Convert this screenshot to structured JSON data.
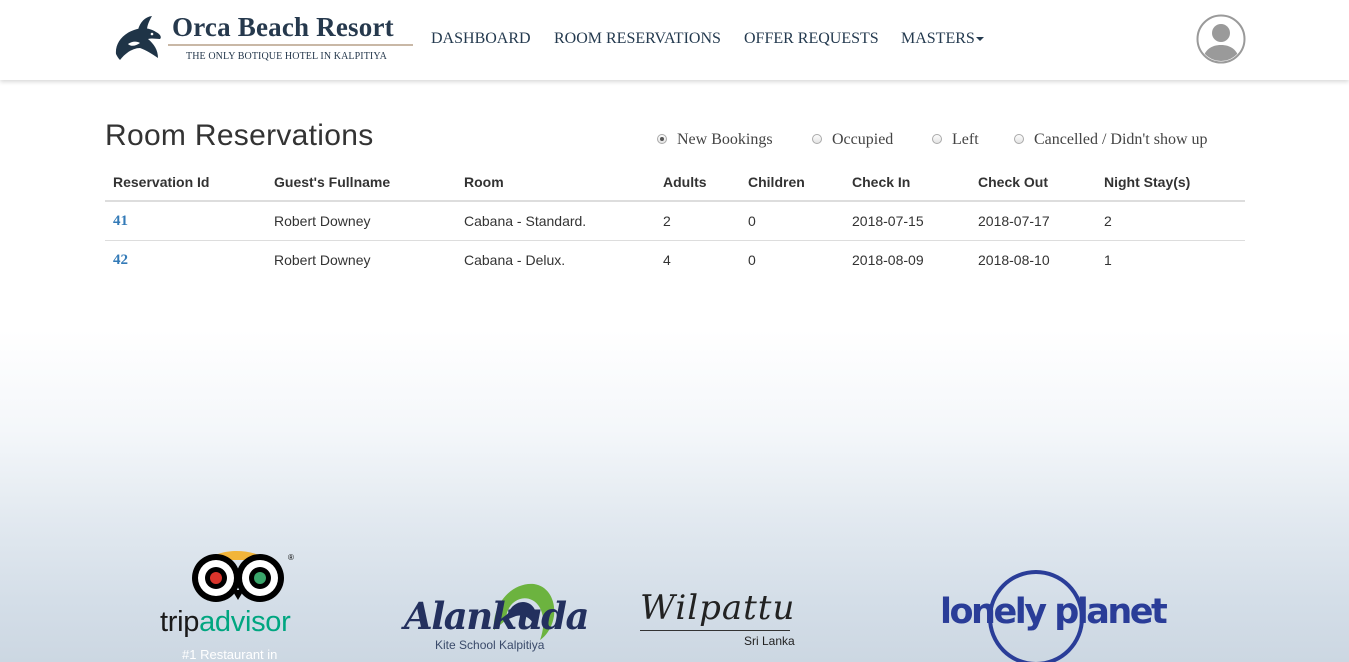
{
  "brand": {
    "name": "Orca Beach Resort",
    "tagline": "THE ONLY BOTIQUE HOTEL IN KALPITIYA"
  },
  "nav": {
    "dashboard": "DASHBOARD",
    "room_reservations": "ROOM RESERVATIONS",
    "offer_requests": "OFFER REQUESTS",
    "masters": "MASTERS"
  },
  "page": {
    "title": "Room Reservations"
  },
  "filters": {
    "selected": "New Bookings",
    "options": [
      "New Bookings",
      "Occupied",
      "Left",
      "Cancelled / Didn't show up"
    ]
  },
  "table": {
    "headers": [
      "Reservation Id",
      "Guest's Fullname",
      "Room",
      "Adults",
      "Children",
      "Check In",
      "Check Out",
      "Night Stay(s)"
    ],
    "rows": [
      [
        "41",
        "Robert Downey",
        "Cabana - Standard.",
        "2",
        "0",
        "2018-07-15",
        "2018-07-17",
        "2"
      ],
      [
        "42",
        "Robert Downey",
        "Cabana - Delux.",
        "4",
        "0",
        "2018-08-09",
        "2018-08-10",
        "1"
      ]
    ]
  },
  "partners": {
    "tripadvisor": {
      "trip": "trip",
      "advisor": "advisor",
      "subtitle": "#1 Restaurant in"
    },
    "alankuda": {
      "name": "Alankuda",
      "subtitle": "Kite School Kalpitiya"
    },
    "wilpattu": {
      "name": "Wilpattu",
      "subtitle": "Sri Lanka"
    },
    "lonely_planet": {
      "name": "lonely planet"
    }
  },
  "colors": {
    "brand_navy": "#26394d",
    "link_blue": "#337ab7",
    "tripadvisor_green": "#00a680",
    "lonely_planet_blue": "#2a3d98"
  }
}
